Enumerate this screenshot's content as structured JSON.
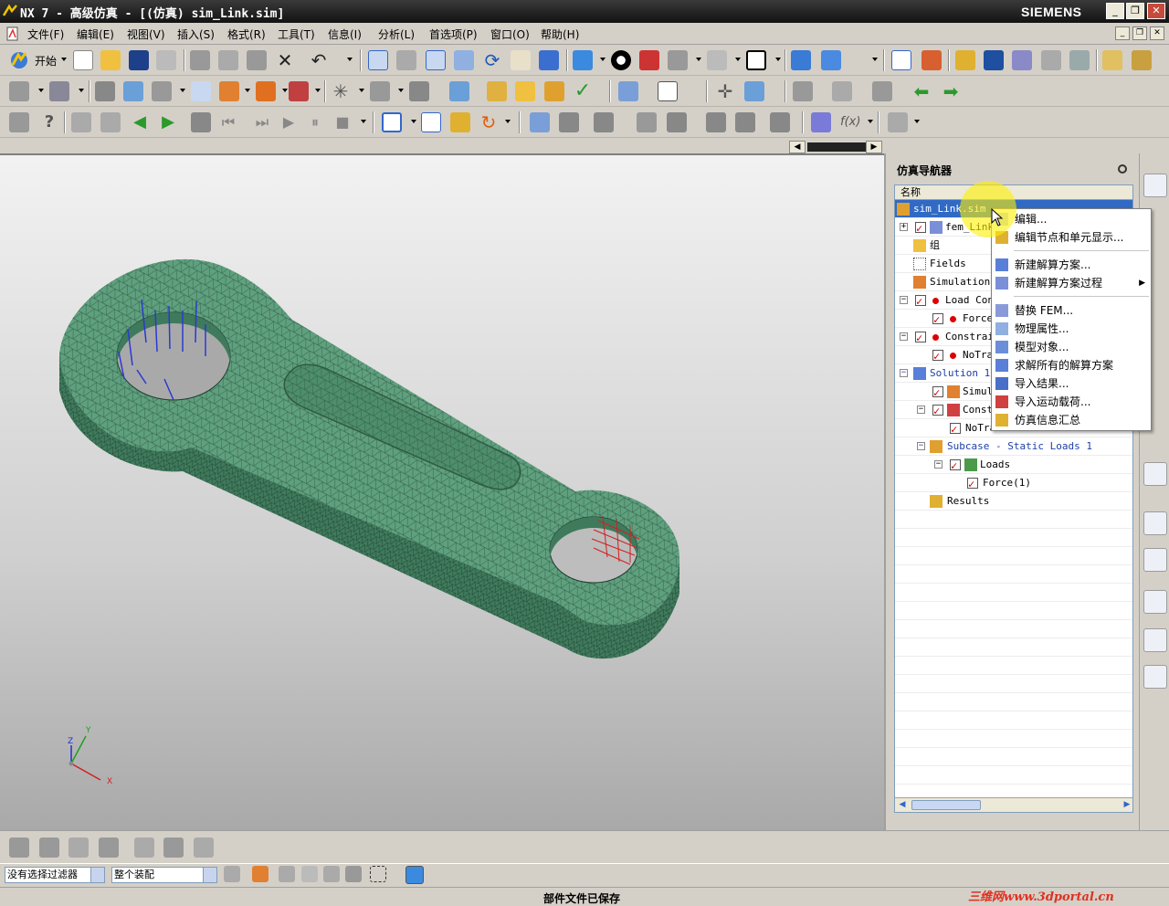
{
  "window": {
    "title": "NX 7 - 高级仿真 - [(仿真) sim_Link.sim]",
    "brand": "SIEMENS"
  },
  "menu": [
    "文件(F)",
    "编辑(E)",
    "视图(V)",
    "插入(S)",
    "格式(R)",
    "工具(T)",
    "信息(I)",
    "分析(L)",
    "首选项(P)",
    "窗口(O)",
    "帮助(H)"
  ],
  "toolbar": {
    "start_label": "开始"
  },
  "navigator": {
    "title": "仿真导航器",
    "column_header": "名称",
    "items": [
      {
        "label": "sim_Link.sim"
      },
      {
        "label": "fem_Link"
      },
      {
        "label": "组"
      },
      {
        "label": "Fields"
      },
      {
        "label": "Simulation"
      },
      {
        "label": "Load Cont"
      },
      {
        "label": "Force"
      },
      {
        "label": "Constrain"
      },
      {
        "label": "NoTran"
      },
      {
        "label": "Solution 1"
      },
      {
        "label": "Simula"
      },
      {
        "label": "Constr"
      },
      {
        "label": "NoTra"
      },
      {
        "label": "Subcase - Static Loads 1"
      },
      {
        "label": "Loads"
      },
      {
        "label": "Force(1)"
      },
      {
        "label": "Results"
      }
    ]
  },
  "context_menu": {
    "items": [
      {
        "label": "编辑..."
      },
      {
        "label": "编辑节点和单元显示..."
      },
      {
        "label": "新建解算方案..."
      },
      {
        "label": "新建解算方案过程"
      },
      {
        "label": "替换 FEM..."
      },
      {
        "label": "物理属性..."
      },
      {
        "label": "模型对象..."
      },
      {
        "label": "求解所有的解算方案"
      },
      {
        "label": "导入结果..."
      },
      {
        "label": "导入运动载荷..."
      },
      {
        "label": "仿真信息汇总"
      }
    ]
  },
  "filters": {
    "selection_filter": "没有选择过滤器",
    "assembly_scope": "整个装配"
  },
  "status": {
    "message": "部件文件已保存"
  },
  "watermark": "三维网www.3dportal.cn",
  "axes": {
    "x": "X",
    "y": "Y",
    "z": "Z"
  },
  "colors": {
    "mesh": "#5fa07e",
    "mesh_edge": "#2f5a45",
    "accent": "#316ac5"
  }
}
